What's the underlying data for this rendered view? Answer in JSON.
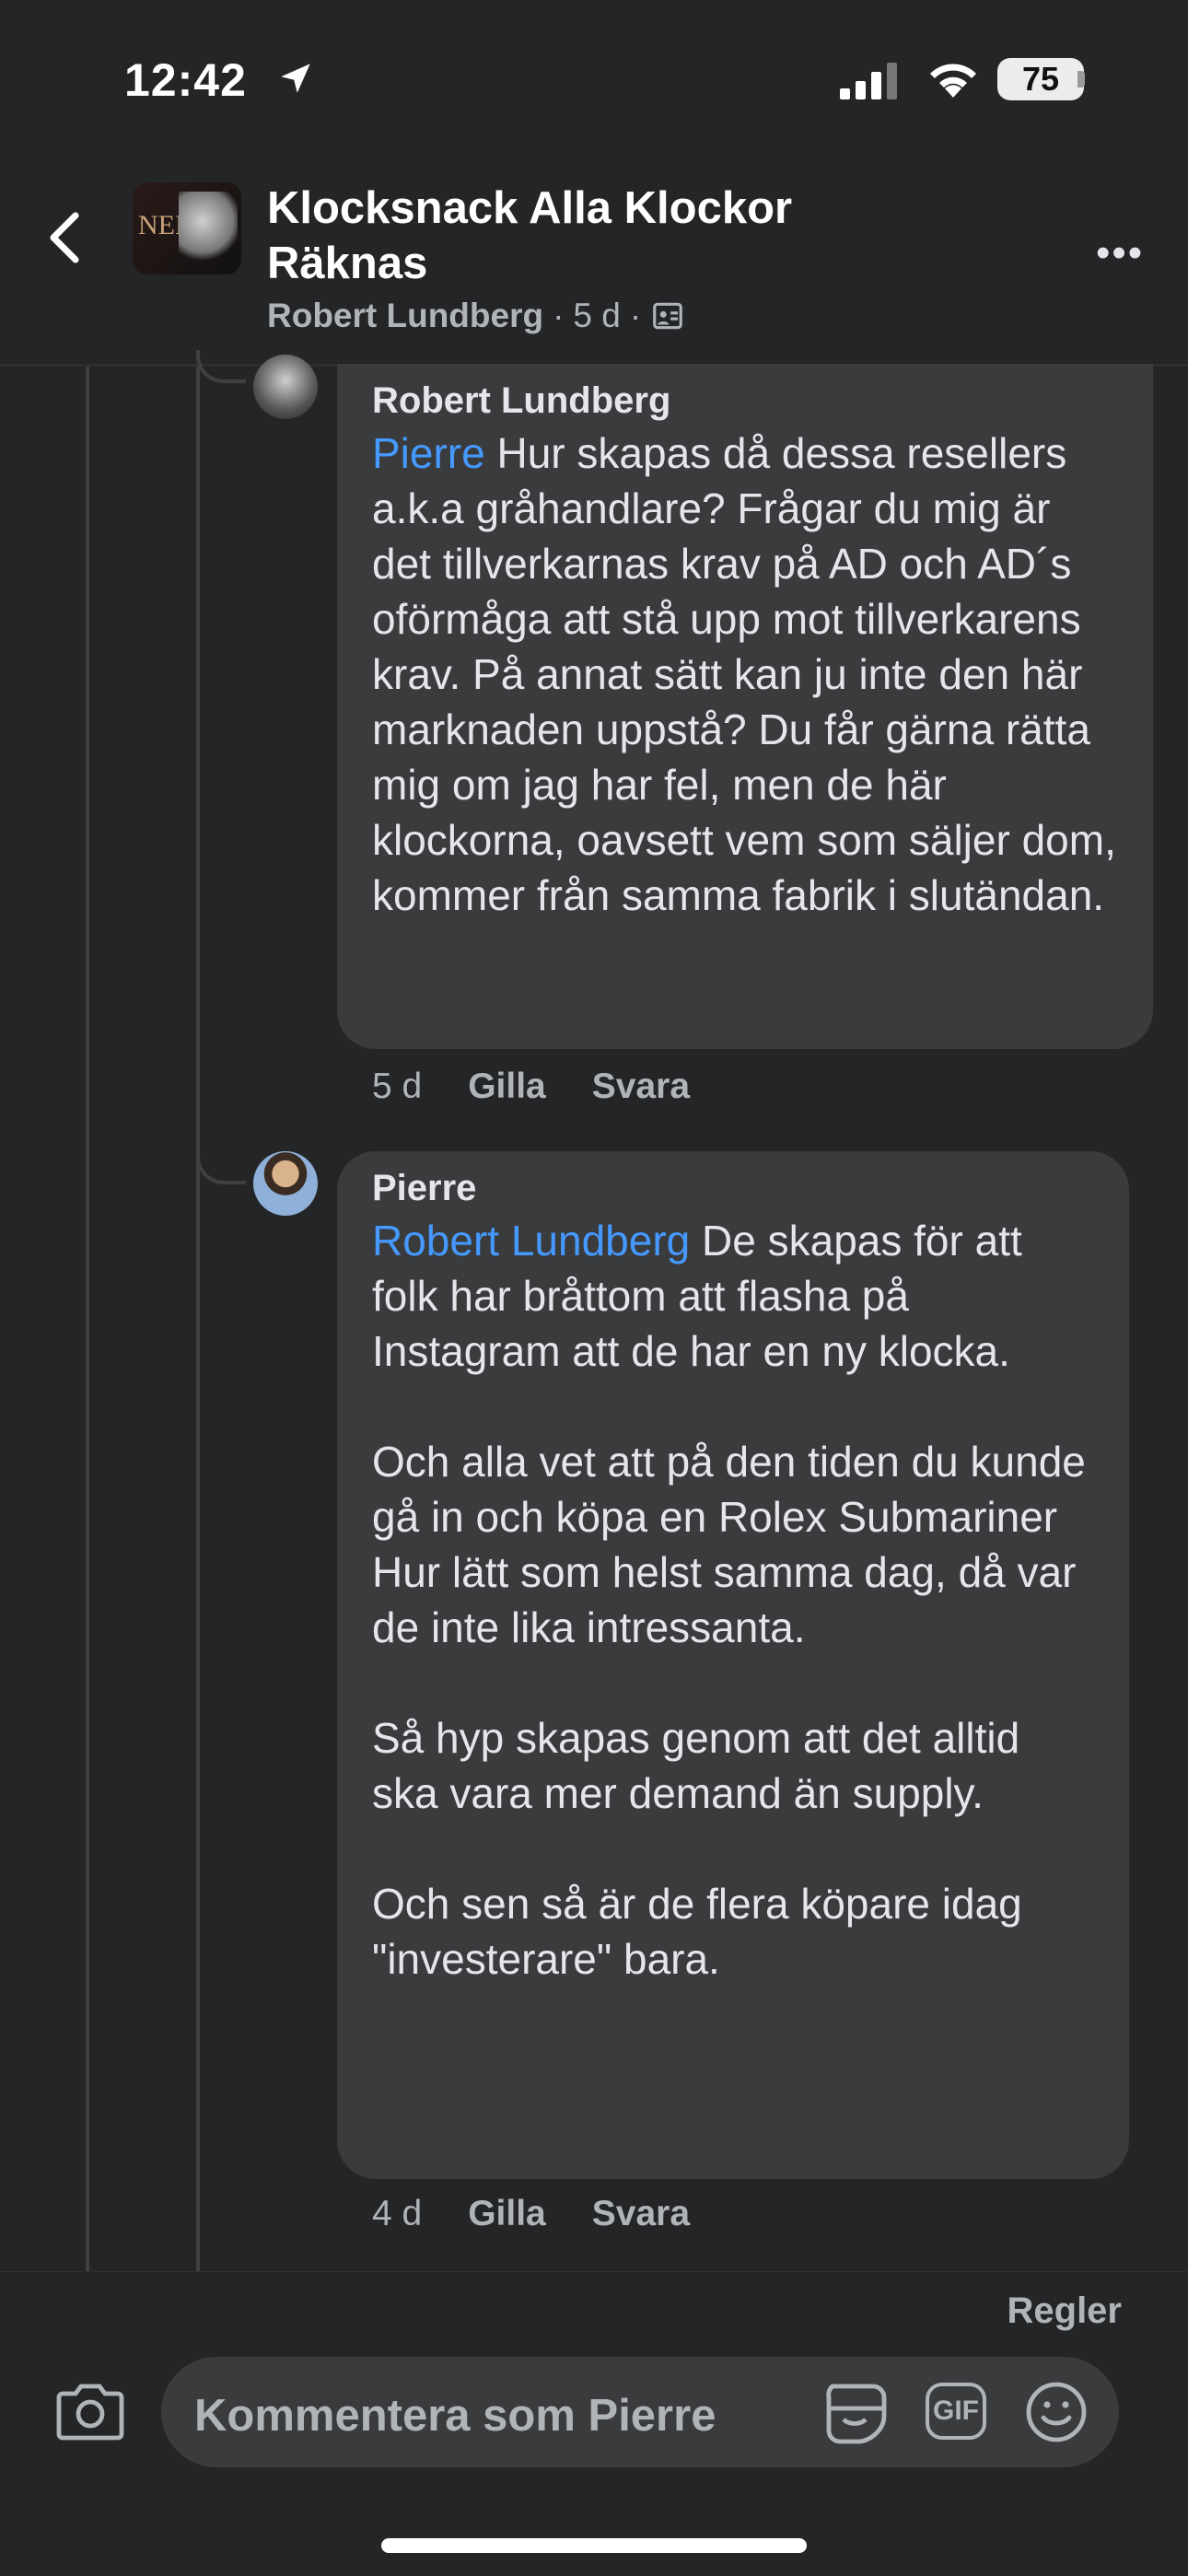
{
  "status_bar": {
    "time": "12:42",
    "battery": "75"
  },
  "header": {
    "group_name": "Klocksnack Alla Klockor Räknas",
    "post_author": "Robert Lundberg",
    "post_age": "5 d",
    "separator": "·"
  },
  "comments": [
    {
      "author": "Robert Lundberg",
      "mention": "Pierre",
      "text": " Hur skapas då dessa resellers a.k.a gråhandlare? Frågar du mig är det tillverkarnas krav på AD och AD´s oförmåga att stå upp mot tillverkarens krav. På annat sätt kan ju inte den här marknaden uppstå? Du får gärna rätta mig om jag har fel, men de här klockorna, oavsett vem som säljer dom, kommer från samma fabrik i slutändan.",
      "age": "5 d",
      "like_label": "Gilla",
      "reply_label": "Svara"
    },
    {
      "author": "Pierre",
      "mention": "Robert Lundberg",
      "text": " De skapas för att folk har bråttom att flasha på Instagram att de har en ny klocka.\n\nOch alla vet att på den tiden du kunde gå in och köpa en Rolex Submariner Hur lätt som helst samma dag, då var de inte lika intressanta.\n\nSå hyp skapas genom att det alltid ska vara mer demand än supply.\n\nOch sen så är de flera köpare idag \"investerare\" bara.",
      "age": "4 d",
      "like_label": "Gilla",
      "reply_label": "Svara"
    }
  ],
  "footer": {
    "rules_label": "Regler",
    "input_placeholder": "Kommentera som Pierre",
    "gif_label": "GIF"
  }
}
